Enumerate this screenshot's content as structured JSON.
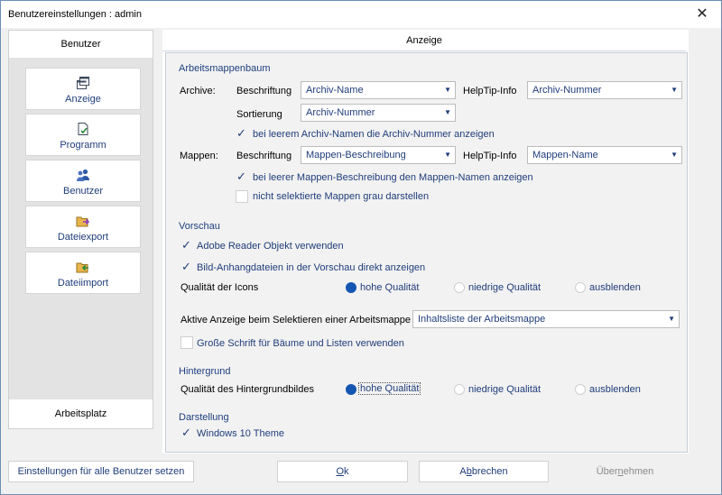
{
  "window": {
    "title": "Benutzereinstellungen : admin",
    "close_glyph": "✕"
  },
  "nav": {
    "header": "Benutzer",
    "items": [
      {
        "label": "Anzeige",
        "icon": "windows-icon"
      },
      {
        "label": "Programm",
        "icon": "document-check-icon"
      },
      {
        "label": "Benutzer",
        "icon": "users-icon"
      },
      {
        "label": "Dateiexport",
        "icon": "folder-export-icon"
      },
      {
        "label": "Dateiimport",
        "icon": "folder-import-icon"
      }
    ],
    "footer": "Arbeitsplatz"
  },
  "panel": {
    "tab": "Anzeige",
    "arbeitsmappenbaum": {
      "heading": "Arbeitsmappenbaum",
      "archive_label": "Archive:",
      "beschriftung_label": "Beschriftung",
      "archive_beschriftung_value": "Archiv-Name",
      "helptip_label": "HelpTip-Info",
      "archive_helptip_value": "Archiv-Nummer",
      "sortierung_label": "Sortierung",
      "sortierung_value": "Archiv-Nummer",
      "chk_archiv_nummer": "bei leerem Archiv-Namen die Archiv-Nummer anzeigen",
      "mappen_label": "Mappen:",
      "mappen_beschriftung_value": "Mappen-Beschreibung",
      "mappen_helptip_value": "Mappen-Name",
      "chk_mappen_namen": "bei leerer Mappen-Beschreibung den Mappen-Namen anzeigen",
      "chk_grau": "nicht selektierte Mappen grau darstellen"
    },
    "vorschau": {
      "heading": "Vorschau",
      "chk_adobe": "Adobe Reader Objekt verwenden",
      "chk_bild": "Bild-Anhangdateien in der Vorschau direkt anzeigen",
      "icons_label": "Qualität der Icons",
      "opt_hoch": "hohe Qualität",
      "opt_niedrig": "niedrige Qualität",
      "opt_aus": "ausblenden",
      "aktive_label": "Aktive Anzeige beim Selektieren einer Arbeitsmappe",
      "aktive_value": "Inhaltsliste der Arbeitsmappe",
      "chk_schrift": "Große Schrift für Bäume und Listen verwenden"
    },
    "hintergrund": {
      "heading": "Hintergrund",
      "quality_label": "Qualität des Hintergrundbildes",
      "opt_hoch": "hohe Qualität",
      "opt_niedrig": "niedrige Qualität",
      "opt_aus": "ausblenden"
    },
    "darstellung": {
      "heading": "Darstellung",
      "chk_theme": "Windows 10 Theme"
    }
  },
  "buttons": {
    "all_users": "Einstellungen für alle Benutzer setzen",
    "ok_pre": "",
    "ok_ul": "O",
    "ok_post": "k",
    "cancel_pre": "A",
    "cancel_ul": "b",
    "cancel_post": "brechen",
    "apply_pre": "Über",
    "apply_ul": "n",
    "apply_post": "ehmen"
  },
  "colors": {
    "accent": "#1556b2",
    "link_text": "#1f3d7a",
    "section": "#1e3f7f"
  }
}
